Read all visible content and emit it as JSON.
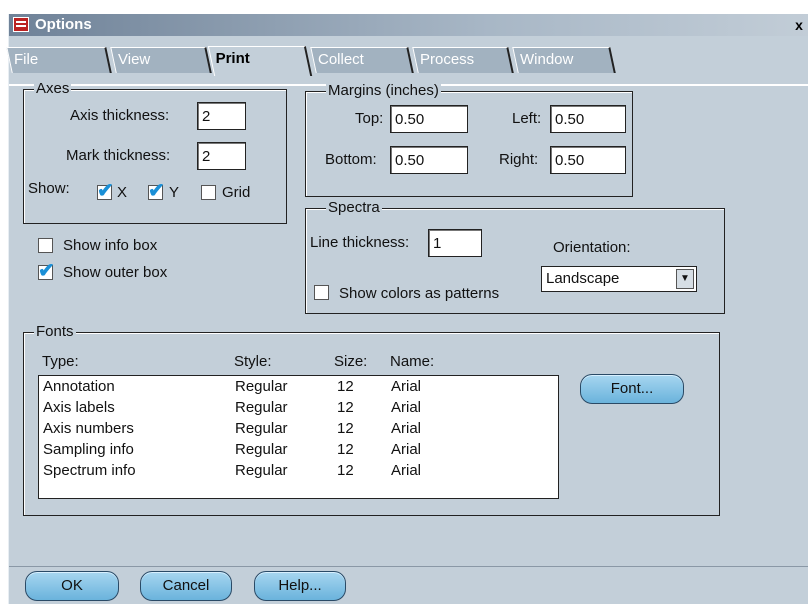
{
  "window": {
    "title": "Options",
    "close_glyph": "x"
  },
  "tabs": [
    "File",
    "View",
    "Print",
    "Collect",
    "Process",
    "Window"
  ],
  "axes": {
    "legend": "Axes",
    "axis_thickness_label": "Axis thickness:",
    "axis_thickness_value": "2",
    "mark_thickness_label": "Mark thickness:",
    "mark_thickness_value": "2",
    "show_label": "Show:",
    "x_label": "X",
    "x_checked": true,
    "y_label": "Y",
    "y_checked": true,
    "grid_label": "Grid",
    "grid_checked": false
  },
  "margins": {
    "legend": "Margins (inches)",
    "top_label": "Top:",
    "top_value": "0.50",
    "left_label": "Left:",
    "left_value": "0.50",
    "bottom_label": "Bottom:",
    "bottom_value": "0.50",
    "right_label": "Right:",
    "right_value": "0.50"
  },
  "options": {
    "show_info_box_label": "Show info box",
    "show_info_box_checked": false,
    "show_outer_box_label": "Show outer box",
    "show_outer_box_checked": true
  },
  "spectra": {
    "legend": "Spectra",
    "line_thickness_label": "Line thickness:",
    "line_thickness_value": "1",
    "orientation_label": "Orientation:",
    "orientation_value": "Landscape",
    "patterns_label": "Show colors as patterns",
    "patterns_checked": false
  },
  "fonts": {
    "legend": "Fonts",
    "headers": {
      "type": "Type:",
      "style": "Style:",
      "size": "Size:",
      "name": "Name:"
    },
    "rows": [
      {
        "type": "Annotation",
        "style": "Regular",
        "size": "12",
        "name": "Arial"
      },
      {
        "type": "Axis labels",
        "style": "Regular",
        "size": "12",
        "name": "Arial"
      },
      {
        "type": "Axis numbers",
        "style": "Regular",
        "size": "12",
        "name": "Arial"
      },
      {
        "type": "Sampling info",
        "style": "Regular",
        "size": "12",
        "name": "Arial"
      },
      {
        "type": "Spectrum info",
        "style": "Regular",
        "size": "12",
        "name": "Arial"
      }
    ],
    "font_button": "Font..."
  },
  "buttons": {
    "ok": "OK",
    "cancel": "Cancel",
    "help": "Help..."
  },
  "colors": {
    "dialog_bg": "#c3cfd9",
    "check": "#1a8fd6",
    "button": "#6ab3dc"
  }
}
